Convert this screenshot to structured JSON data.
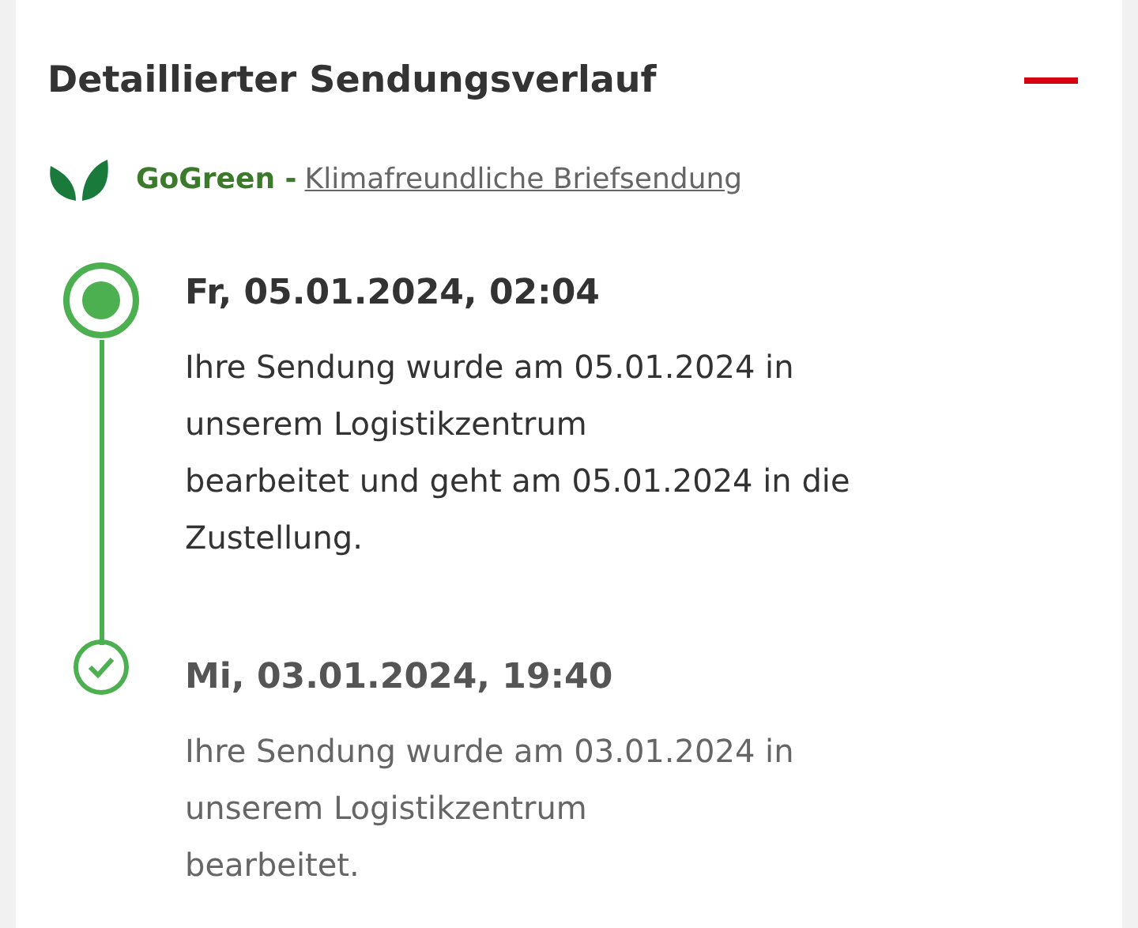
{
  "header": {
    "title": "Detaillierter Sendungsverlauf",
    "expanded": true
  },
  "gogreen": {
    "label": "GoGreen -",
    "link": "Klimafreundliche Briefsendung"
  },
  "events": [
    {
      "kind": "current",
      "time": "Fr, 05.01.2024, 02:04",
      "text": "Ihre Sendung wurde am 05.01.2024 in\nunserem Logistikzentrum\nbearbeitet und geht am 05.01.2024 in die\nZustellung."
    },
    {
      "kind": "done",
      "time": "Mi, 03.01.2024, 19:40",
      "text": "Ihre Sendung wurde am 03.01.2024 in\nunserem Logistikzentrum\nbearbeitet."
    }
  ]
}
